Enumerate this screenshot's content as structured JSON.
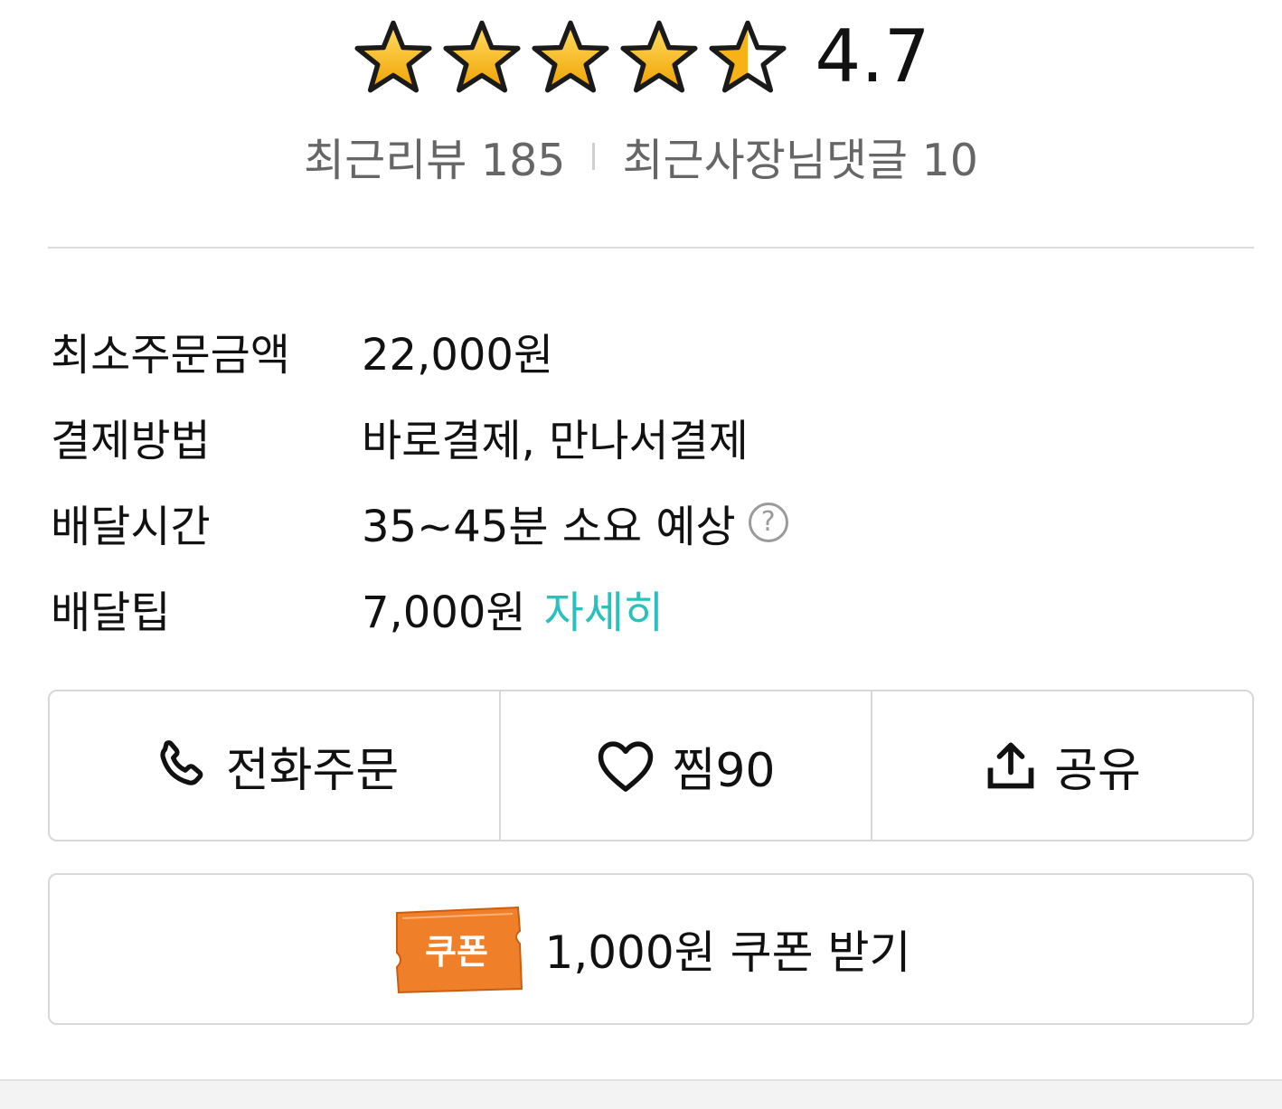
{
  "rating": {
    "value": "4.7",
    "stars_total": 5,
    "stars_filled": 4.7
  },
  "stats": {
    "reviews": "최근리뷰 185",
    "owner_replies": "최근사장님댓글 10"
  },
  "info": [
    {
      "label": "최소주문금액",
      "value": "22,000원"
    },
    {
      "label": "결제방법",
      "value": "바로결제, 만나서결제"
    },
    {
      "label": "배달시간",
      "value": "35~45분 소요 예상"
    },
    {
      "label": "배달팁",
      "value": "7,000원",
      "link": "자세히"
    }
  ],
  "help_glyph": "?",
  "actions": {
    "phone_order": "전화주문",
    "favorite": "찜90",
    "share": "공유"
  },
  "coupon": {
    "badge": "쿠폰",
    "label": "1,000원 쿠폰 받기"
  },
  "colors": {
    "accent": "#2ac1bc",
    "star": "#f9b91a",
    "coupon": "#f07f2a"
  },
  "icons": [
    "star-icon",
    "help-icon",
    "phone-icon",
    "heart-icon",
    "share-icon",
    "coupon-ticket-icon"
  ]
}
